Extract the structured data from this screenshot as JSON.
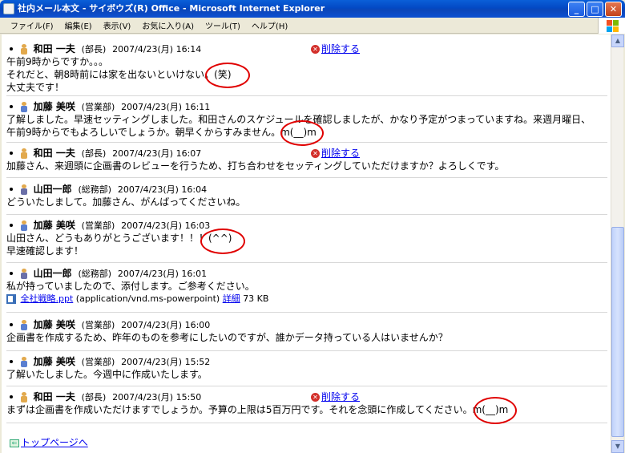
{
  "window": {
    "title": "社内メール本文 - サイボウズ(R) Office - Microsoft Internet Explorer"
  },
  "menu": [
    "ファイル(F)",
    "編集(E)",
    "表示(V)",
    "お気に入り(A)",
    "ツール(T)",
    "ヘルプ(H)"
  ],
  "colors": {
    "manager": "#e2a94d",
    "sales": "#5a7fd0",
    "general": "#6a6fa8",
    "link": "#0000ee",
    "circle": "#e00000"
  },
  "delete_label": "削除する",
  "entries": [
    {
      "name": "和田 一夫",
      "dept": "(部長)",
      "date": "2007/4/23(月) 16:14",
      "lines": [
        "午前9時からですか。。。",
        "それだと、朝8時前には家を出ないといけない。(笑)",
        "大丈夫です！"
      ]
    },
    {
      "name": "加藤 美咲",
      "dept": "(営業部)",
      "date": "2007/4/23(月) 16:11",
      "lines": [
        "了解しました。早速セッティングしました。和田さんのスケジュールを確認しましたが、かなり予定がつまっていますね。来週月曜日、",
        "午前9時からでもよろしいでしょうか。朝早くからすみません。m(__)m"
      ]
    },
    {
      "name": "和田 一夫",
      "dept": "(部長)",
      "date": "2007/4/23(月) 16:07",
      "lines": [
        "加藤さん、来週頭に企画書のレビューを行うため、打ち合わせをセッティングしていただけますか？よろしくです。"
      ]
    },
    {
      "name": "山田一郎",
      "dept": "(総務部)",
      "date": "2007/4/23(月) 16:04",
      "lines": [
        "どういたしまして。加藤さん、がんばってくださいね。"
      ]
    },
    {
      "name": "加藤 美咲",
      "dept": "(営業部)",
      "date": "2007/4/23(月) 16:03",
      "lines": [
        "山田さん、どうもありがとうございます！！！(^^)",
        "早速確認します！"
      ]
    },
    {
      "name": "山田一郎",
      "dept": "(総務部)",
      "date": "2007/4/23(月) 16:01",
      "lines": [
        "私が持っていましたので、添付します。ご参考ください。"
      ],
      "attachment": {
        "filename": "全社戦略.ppt",
        "type": "(application/vnd.ms-powerpoint)",
        "detail": "詳細",
        "size": "73 KB"
      }
    },
    {
      "name": "加藤 美咲",
      "dept": "(営業部)",
      "date": "2007/4/23(月) 16:00",
      "lines": [
        "企画書を作成するため、昨年のものを参考にしたいのですが、誰かデータ持っている人はいませんか？"
      ]
    },
    {
      "name": "加藤 美咲",
      "dept": "(営業部)",
      "date": "2007/4/23(月) 15:52",
      "lines": [
        "了解いたしました。今週中に作成いたします。"
      ]
    },
    {
      "name": "和田 一夫",
      "dept": "(部長)",
      "date": "2007/4/23(月) 15:50",
      "lines": [
        "まずは企画書を作成いただけますでしょうか。予算の上限は5百万円です。それを念頭に作成してください。m(__)m"
      ]
    }
  ],
  "top_link": "トップページへ"
}
